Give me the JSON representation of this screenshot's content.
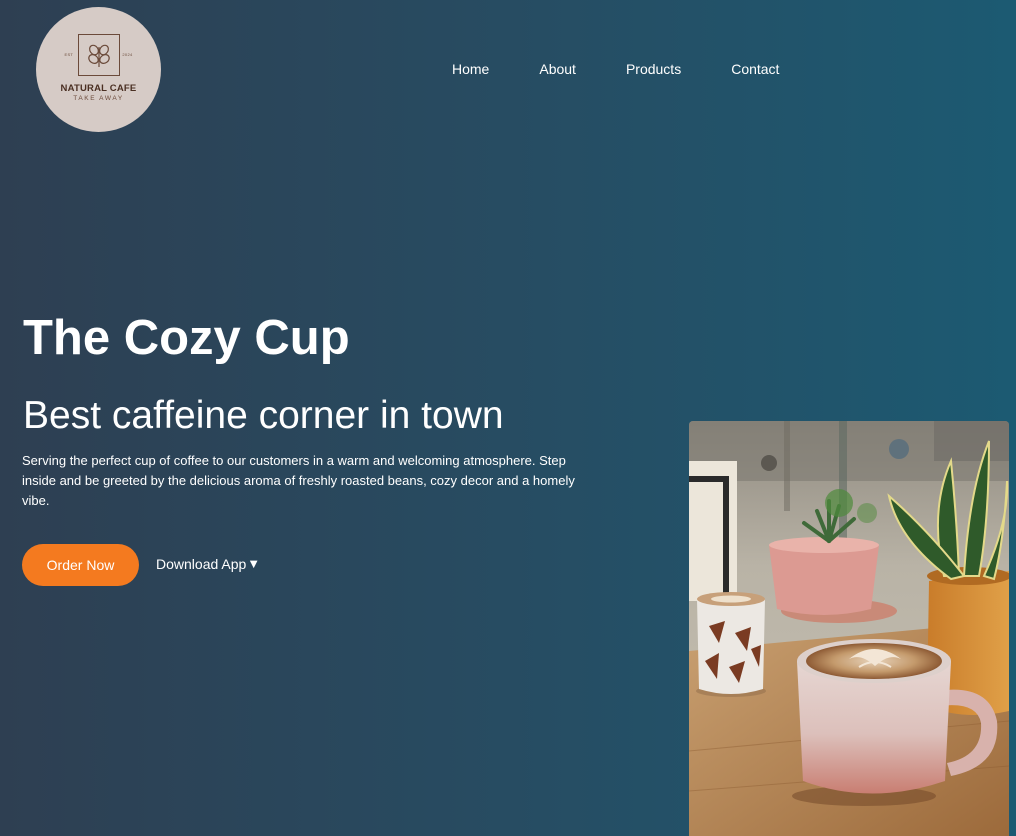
{
  "logo": {
    "name": "NATURAL CAFE",
    "tagline": "TAKE AWAY",
    "est_left": "EST",
    "est_right": "2024"
  },
  "nav": {
    "items": [
      {
        "label": "Home"
      },
      {
        "label": "About"
      },
      {
        "label": "Products"
      },
      {
        "label": "Contact"
      }
    ]
  },
  "hero": {
    "title": "The Cozy Cup",
    "subtitle": "Best caffeine corner in town",
    "description": "Serving the perfect cup of coffee to our customers in a warm and welcoming atmosphere. Step inside and be greeted by the delicious aroma of freshly roasted beans, cozy decor and a homely vibe.",
    "order_button": "Order Now",
    "download_label": "Download App",
    "download_icon": "▼"
  },
  "colors": {
    "accent": "#f47a1f",
    "background_left": "#2e3f52",
    "background_right": "#1c5a72",
    "logo_bg": "#d6cbc6"
  },
  "icons": {
    "logo_mark": "coffee-beans-icon",
    "download": "caret-down-icon"
  }
}
